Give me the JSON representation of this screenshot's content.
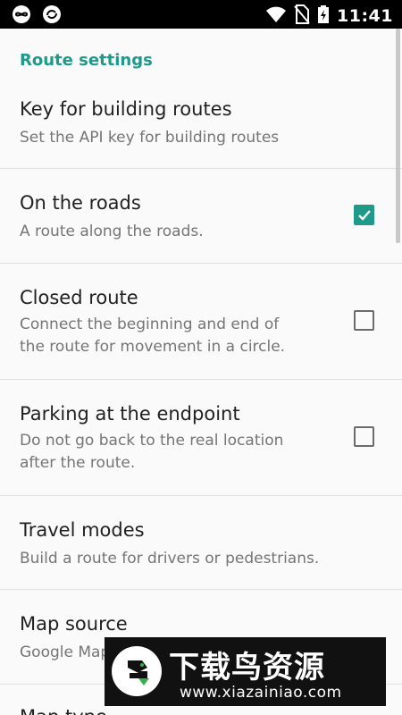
{
  "status_bar": {
    "time": "11:41",
    "icons": [
      "infinity-icon",
      "sync-icon",
      "wifi-icon",
      "no-sim-icon",
      "battery-charging-icon"
    ]
  },
  "category": "Route settings",
  "items": [
    {
      "title": "Key for building routes",
      "summary": "Set the API key for building routes"
    },
    {
      "title": "On the roads",
      "summary": "A route along the roads.",
      "checked": true
    },
    {
      "title": "Closed route",
      "summary_lines": [
        "Connect the beginning and end of",
        "the route for movement in a circle."
      ],
      "checked": false
    },
    {
      "title": "Parking at the endpoint",
      "summary_lines": [
        "Do not go back to the real location",
        "after the route."
      ],
      "checked": false
    },
    {
      "title": "Travel modes",
      "summary": "Build a route for drivers or pedestrians."
    },
    {
      "title": "Map source",
      "summary": "Google Maps"
    },
    {
      "title": "Map type"
    }
  ],
  "watermark": {
    "brand": "下载鸟资源",
    "url": "www.xiazainiao.com"
  },
  "colors": {
    "accent": "#1e9a8a",
    "status_bar": "#000000",
    "background": "#fafafa"
  }
}
